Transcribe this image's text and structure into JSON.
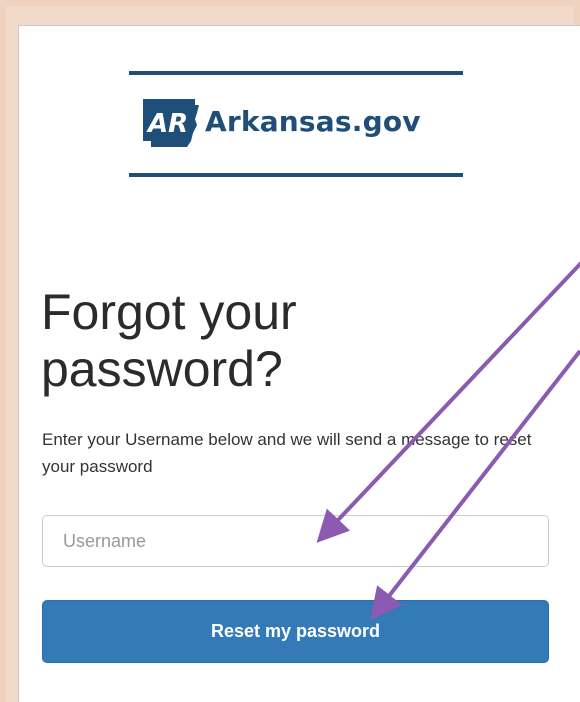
{
  "brand": {
    "logo_text": "Arkansas.gov",
    "mark_text": "AR",
    "color": "#1f4e79"
  },
  "page": {
    "title": "Forgot your password?",
    "description": "Enter your Username below and we will send a message to reset your password"
  },
  "form": {
    "username": {
      "placeholder": "Username",
      "value": ""
    },
    "submit_label": "Reset my password"
  },
  "colors": {
    "primary_button": "#337ab7",
    "annotation_arrow": "#8a5bb0",
    "background": "#f2d9c9"
  },
  "annotations": {
    "arrows": [
      "username-input",
      "reset-password-button"
    ]
  }
}
